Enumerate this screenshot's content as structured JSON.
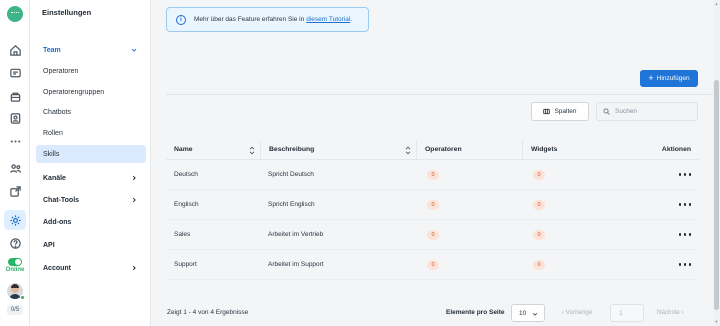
{
  "subnav": {
    "title": "Einstellungen",
    "team_label": "Team",
    "team_items": [
      "Operatoren",
      "Operatorengruppen",
      "Chatbots",
      "Rollen",
      "Skills"
    ],
    "sections": [
      "Kanäle",
      "Chat-Tools",
      "Add-ons",
      "API",
      "Account"
    ]
  },
  "rail": {
    "status": "Online",
    "counter": "0/5"
  },
  "info": {
    "text": "Mehr über das Feature erfahren Sie in",
    "link": "diesem Tutorial",
    "suffix": "."
  },
  "toolbar": {
    "add_label": "Hinzufügen",
    "columns_label": "Spalten",
    "search_placeholder": "Suchen"
  },
  "table": {
    "headers": [
      "Name",
      "Beschreibung",
      "Operatoren",
      "Widgets",
      "Aktionen"
    ],
    "rows": [
      {
        "name": "Deutsch",
        "description": "Spricht Deutsch",
        "operators": "0",
        "widgets": "0"
      },
      {
        "name": "Englisch",
        "description": "Spricht Englisch",
        "operators": "0",
        "widgets": "0"
      },
      {
        "name": "Sales",
        "description": "Arbeitet im Vertrieb",
        "operators": "0",
        "widgets": "0"
      },
      {
        "name": "Support",
        "description": "Arbeitet im Support",
        "operators": "0",
        "widgets": "0"
      }
    ]
  },
  "pagination": {
    "summary": "Zeigt 1 - 4 von 4 Ergebnisse",
    "per_page_label": "Elemente pro Seite",
    "per_page_value": "10",
    "prev_label": "Vorherige",
    "page_value": "1",
    "next_label": "Nächste"
  },
  "colors": {
    "accent": "#1f74d8",
    "active_nav_bg": "#dceaff",
    "online": "#2ab36b",
    "badge_bg": "#fde2d8",
    "info_bg": "#e9f5ff"
  },
  "icons": [
    "logo-icon",
    "home-icon",
    "chat-icon",
    "inbox-icon",
    "contacts-icon",
    "more-icon",
    "team-icon",
    "share-icon",
    "settings-icon",
    "help-icon",
    "info-icon",
    "plus-icon",
    "columns-icon",
    "search-icon",
    "sort-icon",
    "kebab-icon",
    "chevron-down-icon",
    "chevron-right-icon"
  ]
}
